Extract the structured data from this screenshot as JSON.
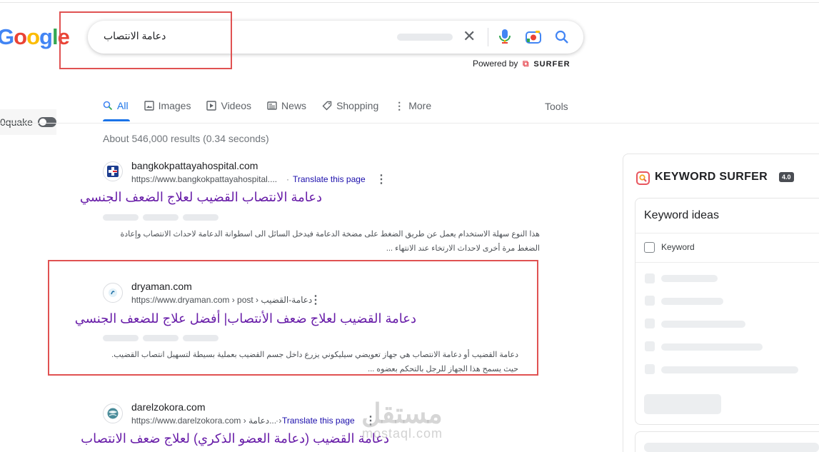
{
  "logo": {
    "text": [
      "G",
      "o",
      "o",
      "g",
      "l",
      "e"
    ],
    "colors": [
      "#4285f4",
      "#ea4335",
      "#fbbc05",
      "#4285f4",
      "#34a853",
      "#ea4335"
    ]
  },
  "search": {
    "query": "دعامة الانتصاب"
  },
  "powered": {
    "label": "Powered by",
    "brand": "SURFER"
  },
  "tabs": [
    {
      "label": "All",
      "icon": "search-icon"
    },
    {
      "label": "Images",
      "icon": "image-icon"
    },
    {
      "label": "Videos",
      "icon": "play-icon"
    },
    {
      "label": "News",
      "icon": "newspaper-icon"
    },
    {
      "label": "Shopping",
      "icon": "tag-icon"
    },
    {
      "label": "More",
      "icon": "more-vert-icon"
    }
  ],
  "tools_label": "Tools",
  "quake_label": "0quake",
  "stats": "About 546,000 results (0.34 seconds)",
  "results": [
    {
      "site": "bangkokpattayahospital.com",
      "url": "https://www.bangkokpattayahospital....",
      "translate": "Translate this page",
      "title": "دعامة الانتصاب القضيب لعلاج الضعف الجنسي",
      "snippet1": "هذا النوع سهلة الاستخدام يعمل عن طريق الضغط على مضخة الدعامة فيدخل السائل الى اسطوانة الدعامة لاحداث الانتصاب وإعادة",
      "snippet2": "الضغط مرة أخرى لاحداث الارتخاء عند الانتهاء ..."
    },
    {
      "site": "dryaman.com",
      "url": "https://www.dryaman.com › post › دعامة-القضيب",
      "translate": "",
      "title": "دعامة القضيب لعلاج ضعف الأنتصاب| أفضل علاج للضعف الجنسي",
      "snippet1": "دعامة القضيب أو دعامة الانتصاب هي جهاز تعويضي سيليكوني يزرع داخل جسم القضيب بعملية بسيطة لتسهيل انتصاب القضيب.",
      "snippet2": "حيث يسمح هذا الجهاز للرجل بالتحكم بعضوه ..."
    },
    {
      "site": "darelzokora.com",
      "url": "https://www.darelzokora.com › دعامة... ›",
      "translate": "Translate this page",
      "title": "دعامة القضيب (دعامة العضو الذكري) لعلاج ضعف الانتصاب",
      "snippet1": "",
      "snippet2": ""
    }
  ],
  "surfer": {
    "title": "KEYWORD SURFER",
    "version": "4.0",
    "ideas_title": "Keyword ideas",
    "keyword_col": "Keyword"
  },
  "watermark": {
    "arabic": "مستقل",
    "latin": "mostaql.com"
  }
}
